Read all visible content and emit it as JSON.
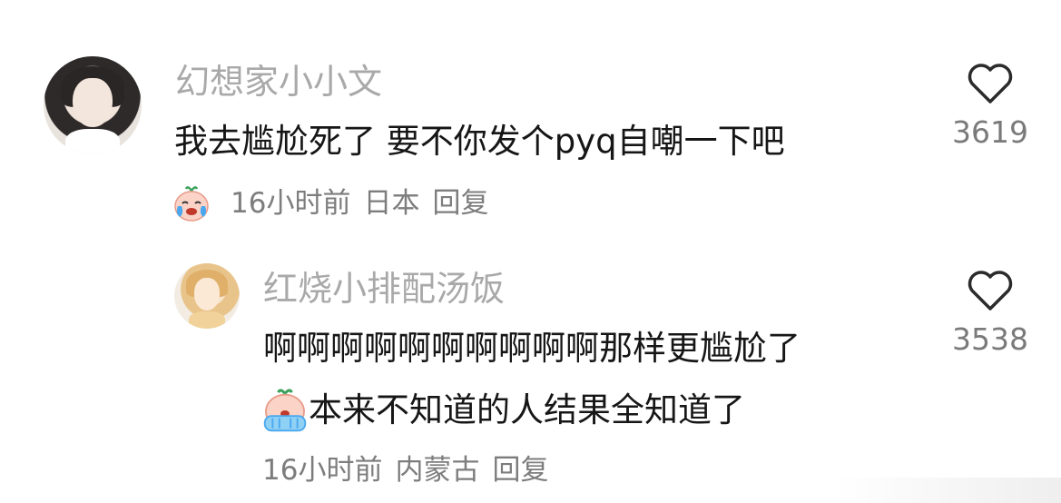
{
  "comments": [
    {
      "username": "幻想家小小文",
      "text": "我去尴尬死了 要不你发个pyq自嘲一下吧",
      "time": "16小时前",
      "location": "日本",
      "reply_label": "回复",
      "likes": "3619",
      "reaction_emoji": "crying-laughing-sticker"
    },
    {
      "username": "红烧小排配汤饭",
      "text_line1": "啊啊啊啊啊啊啊啊啊啊那样更尴尬了",
      "text_line2": "本来不知道的人结果全知道了",
      "time": "16小时前",
      "location": "内蒙古",
      "reply_label": "回复",
      "likes": "3538",
      "reaction_emoji": "covering-face-sticker"
    }
  ],
  "icons": {
    "like": "heart-outline-icon"
  },
  "colors": {
    "username": "#a9a9a9",
    "text": "#161616",
    "meta": "#7d7d7d"
  }
}
